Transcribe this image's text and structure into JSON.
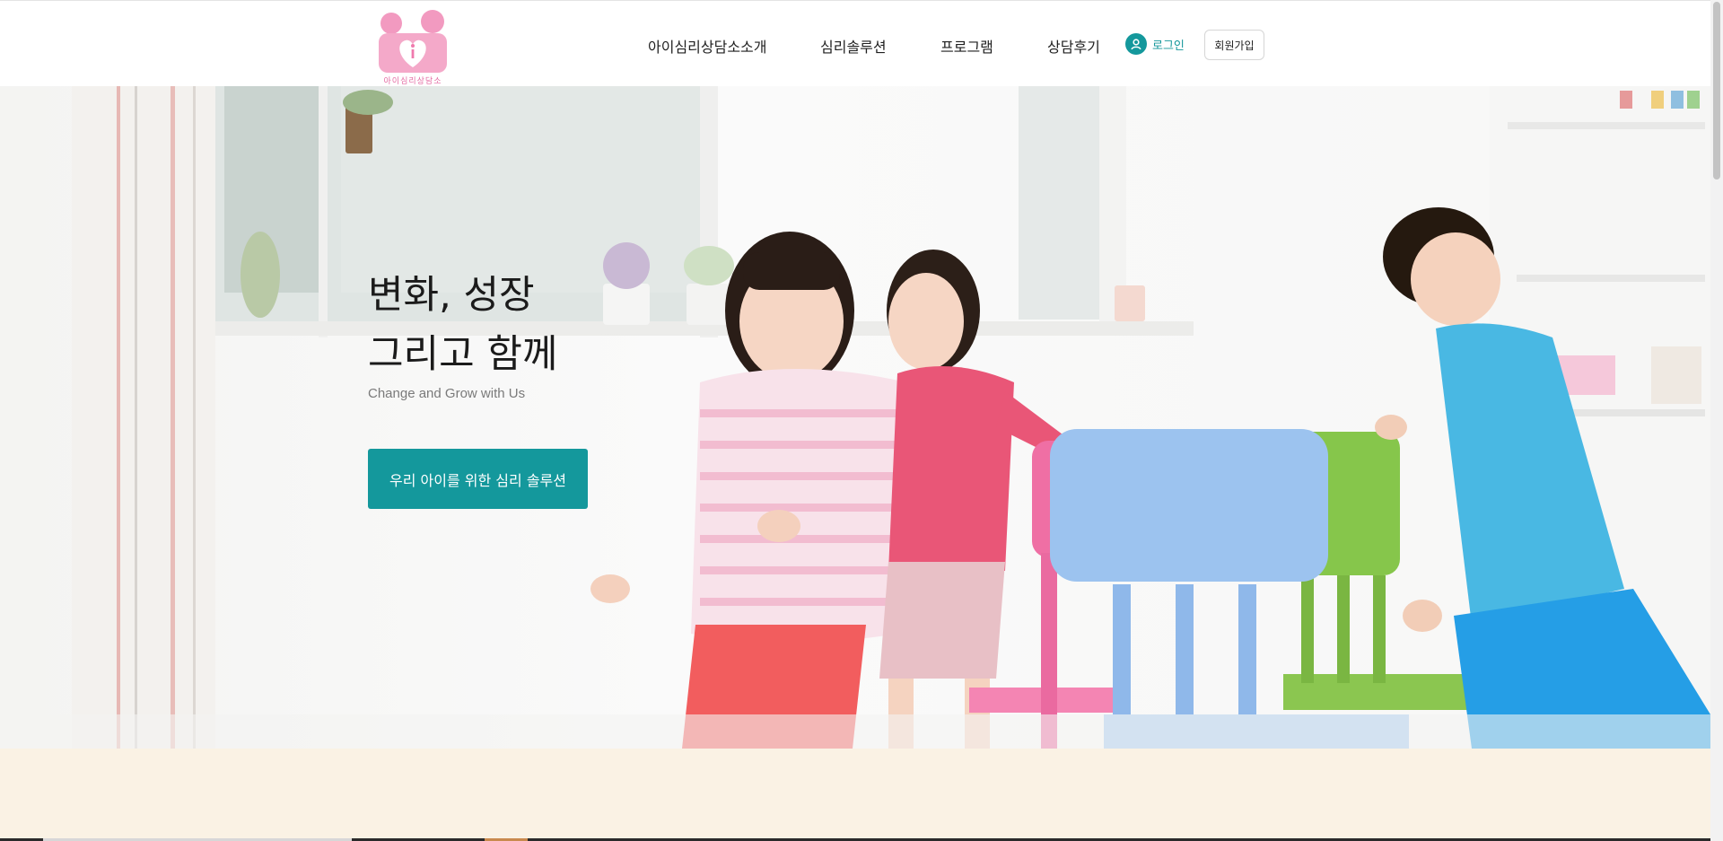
{
  "logo": {
    "caption": "아이심리상담소",
    "brand_color": "#f2a6c7"
  },
  "nav": {
    "items": [
      "아이심리상담소소개",
      "심리솔루션",
      "프로그램",
      "상담후기"
    ],
    "login_label": "로그인",
    "signup_label": "회원가입",
    "accent": "#14989c"
  },
  "hero": {
    "title_line1": "변화, 성장",
    "title_line2": "그리고 함께",
    "subtitle": "Change and Grow with Us",
    "cta_label": "우리 아이를 위한 심리 솔루션",
    "cta_color": "#14989c"
  },
  "lower": {
    "background": "#faf2e4"
  },
  "icons": [
    "user-icon",
    "heart-logo-icon"
  ]
}
